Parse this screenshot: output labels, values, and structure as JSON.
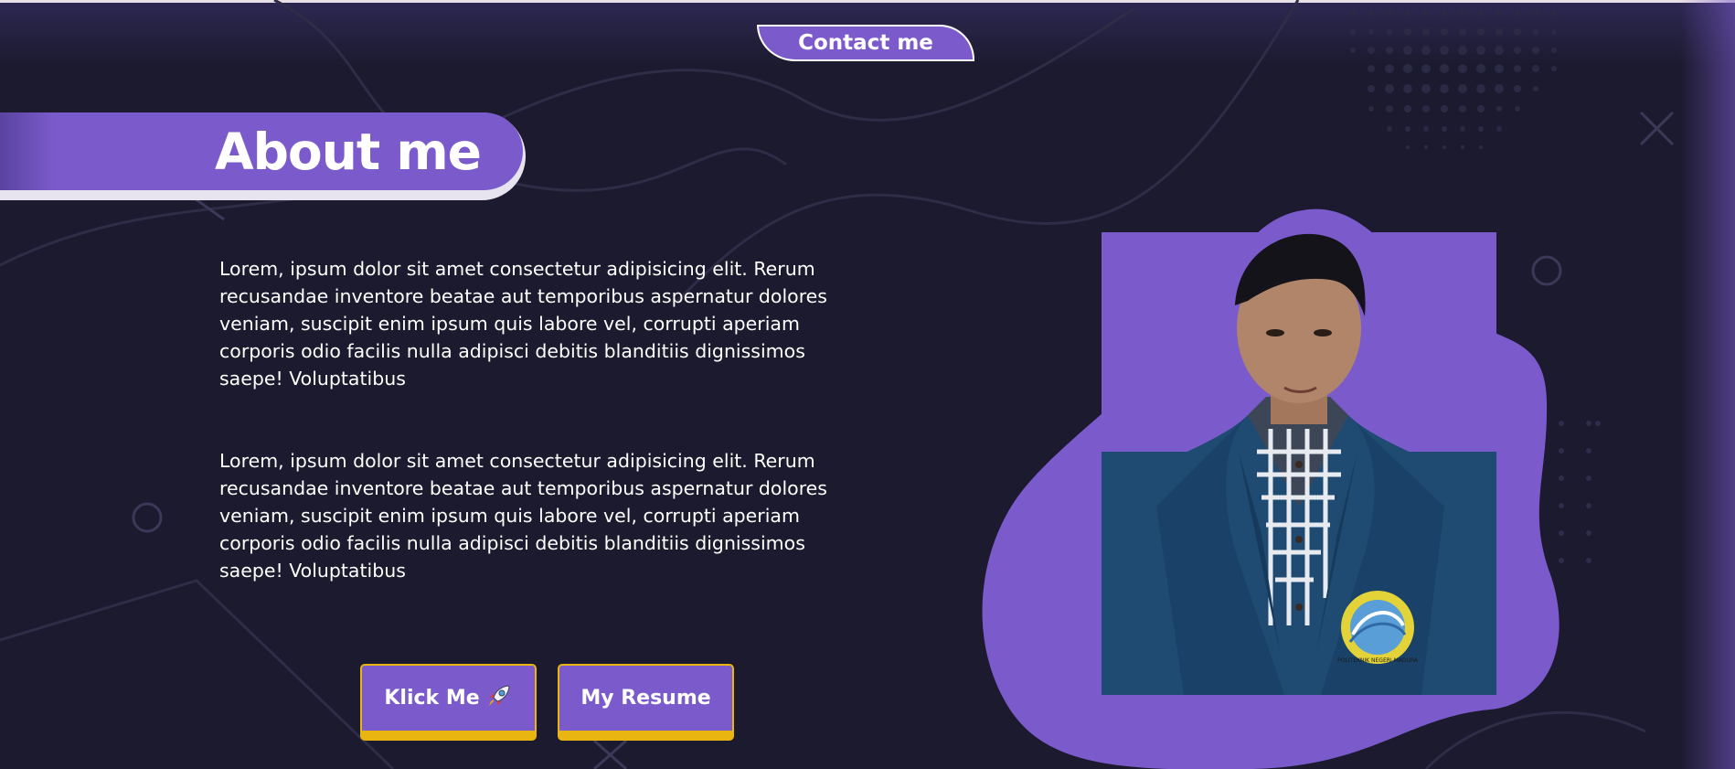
{
  "nav": {
    "contact_label": "Contact me"
  },
  "about": {
    "title": "About me",
    "paragraphs": [
      "Lorem, ipsum dolor sit amet consectetur adipisicing elit. Rerum recusandae inventore beatae aut temporibus aspernatur dolores veniam, suscipit enim ipsum quis labore vel, corrupti aperiam corporis odio facilis nulla adipisci debitis blanditiis dignissimos saepe! Voluptatibus",
      "Lorem, ipsum dolor sit amet consectetur adipisicing elit. Rerum recusandae inventore beatae aut temporibus aspernatur dolores veniam, suscipit enim ipsum quis labore vel, corrupti aperiam corporis odio facilis nulla adipisci debitis blanditiis dignissimos saepe! Voluptatibus"
    ]
  },
  "actions": {
    "klick_label": "Klick Me",
    "klick_icon": "rocket-icon",
    "resume_label": "My Resume"
  },
  "photo": {
    "badge_text": "POLITEKNIK NEGERI MADURA"
  },
  "colors": {
    "background": "#1b1a2e",
    "accent": "#7b5bcc",
    "button_border": "#e8b511",
    "text": "#ffffff"
  }
}
